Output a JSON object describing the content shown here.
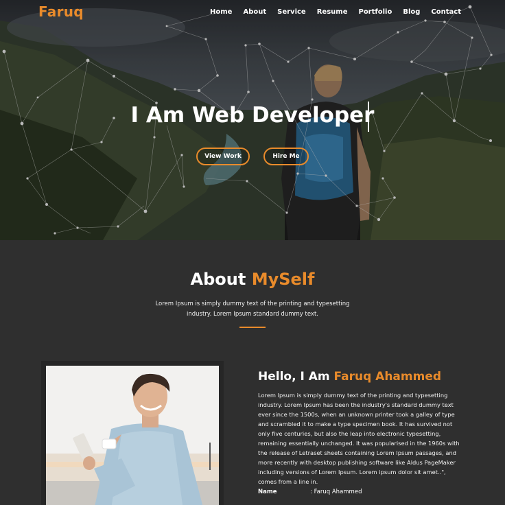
{
  "brand": {
    "logo": "Faruq",
    "accent_color": "#e98b2b"
  },
  "nav": {
    "items": [
      "Home",
      "About",
      "Service",
      "Resume",
      "Portfolio",
      "Blog",
      "Contact"
    ]
  },
  "hero": {
    "title": "I Am Web Developer",
    "buttons": {
      "view_work": "View Work",
      "hire_me": "Hire Me"
    }
  },
  "about": {
    "heading_main": "About",
    "heading_accent": "MySelf",
    "subtitle": "Lorem Ipsum is simply dummy text of the printing and typesetting industry. Lorem Ipsum standard dummy text.",
    "hello_prefix": "Hello, I Am",
    "hello_name": "Faruq Ahammed",
    "bio": "Lorem Ipsum is simply dummy text of the printing and typesetting industry. Lorem Ipsum has been the industry's standard dummy text ever since the 1500s, when an unknown printer took a galley of type and scrambled it to make a type specimen book. It has survived not only five centuries, but also the leap into electronic typesetting, remaining essentially unchanged. It was popularised in the 1960s with the release of Letraset sheets containing Lorem Ipsum passages, and more recently with desktop publishing software like Aldus PageMaker including versions of Lorem Ipsum. Lorem ipsum dolor sit amet..\", comes from a line in.",
    "info": {
      "name_label": "Name",
      "name_value": ": Faruq Ahammed"
    }
  }
}
